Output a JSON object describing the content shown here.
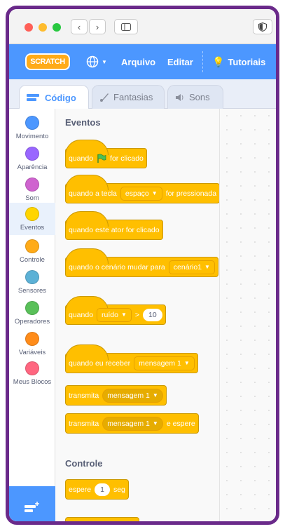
{
  "menubar": {
    "logo": "SCRATCH",
    "file": "Arquivo",
    "edit": "Editar",
    "tutorials": "Tutoriais"
  },
  "tabs": [
    {
      "label": "Código",
      "icon": "code-icon"
    },
    {
      "label": "Fantasias",
      "icon": "brush-icon"
    },
    {
      "label": "Sons",
      "icon": "speaker-icon"
    }
  ],
  "categories": [
    {
      "label": "Movimento",
      "color": "#4c97ff"
    },
    {
      "label": "Aparência",
      "color": "#9966ff"
    },
    {
      "label": "Som",
      "color": "#cf63cf"
    },
    {
      "label": "Eventos",
      "color": "#ffd500"
    },
    {
      "label": "Controle",
      "color": "#ffab19"
    },
    {
      "label": "Sensores",
      "color": "#5cb1d6"
    },
    {
      "label": "Operadores",
      "color": "#59c059"
    },
    {
      "label": "Variáveis",
      "color": "#ff8c1a"
    },
    {
      "label": "Meus Blocos",
      "color": "#ff6680"
    }
  ],
  "sections": {
    "events": "Eventos",
    "control": "Controle"
  },
  "blocks": {
    "flag_when": "quando",
    "flag_clicked": "for clicado",
    "key_when": "quando a tecla",
    "key_value": "espaço",
    "key_pressed": "for pressionada",
    "sprite_clicked": "quando este ator for clicado",
    "backdrop_when": "quando o cenário mudar para",
    "backdrop_value": "cenário1",
    "sensor_when": "quando",
    "sensor_value": "ruído",
    "sensor_op": ">",
    "sensor_num": "10",
    "receive_when": "quando eu receber",
    "receive_value": "mensagem 1",
    "broadcast": "transmita",
    "broadcast_value": "mensagem 1",
    "broadcast_wait": "transmita",
    "broadcast_wait_value": "mensagem 1",
    "broadcast_wait_suffix": "e espere",
    "wait": "espere",
    "wait_num": "1",
    "wait_unit": "seg"
  },
  "colors": {
    "accent": "#4c97ff",
    "events": "#ffbf00",
    "frame": "#6a2a8a"
  }
}
